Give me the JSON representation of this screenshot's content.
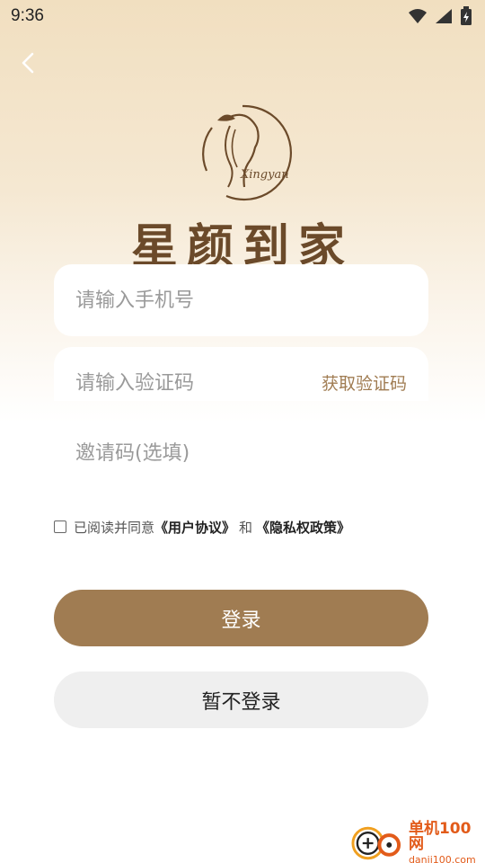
{
  "status_bar": {
    "time": "9:36"
  },
  "brand": {
    "logo_text": "Xingyan",
    "title": "星颜到家"
  },
  "form": {
    "phone_placeholder": "请输入手机号",
    "code_placeholder": "请输入验证码",
    "get_code_label": "获取验证码",
    "invite_placeholder": "邀请码(选填)"
  },
  "agreement": {
    "prefix": "已阅读并同意",
    "user_agreement": "《用户协议》",
    "and": "和",
    "privacy_policy": "《隐私权政策》"
  },
  "buttons": {
    "login_label": "登录",
    "skip_label": "暂不登录"
  },
  "watermark": {
    "main": "单机100网",
    "sub": "danji100.com"
  },
  "colors": {
    "accent": "#a07c52",
    "brand_text": "#6b4a2a",
    "watermark": "#e25b1a"
  }
}
